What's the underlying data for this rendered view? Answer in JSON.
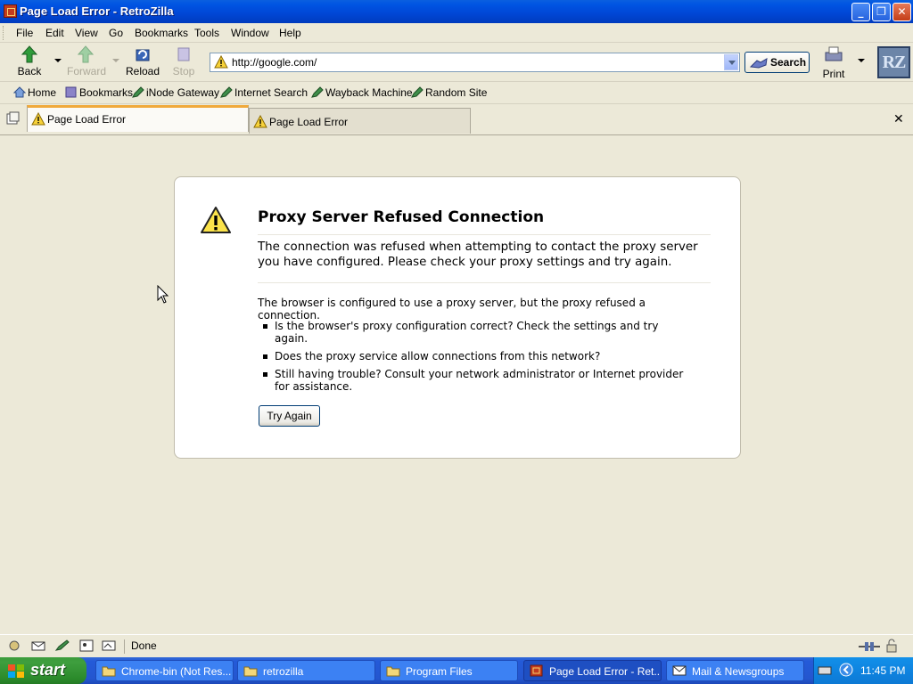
{
  "window": {
    "title": "Page Load Error - RetroZilla",
    "minimize": "_",
    "maximize": "❐",
    "close": "✕"
  },
  "menu": [
    "File",
    "Edit",
    "View",
    "Go",
    "Bookmarks",
    "Tools",
    "Window",
    "Help"
  ],
  "nav": {
    "back": "Back",
    "forward": "Forward",
    "reload": "Reload",
    "stop": "Stop",
    "url": "http://google.com/",
    "search": "Search",
    "print": "Print",
    "logo": "RZ"
  },
  "personal_toolbar": [
    "Home",
    "Bookmarks",
    "iNode Gateway",
    "Internet Search",
    "Wayback Machine",
    "Random Site"
  ],
  "tabs": [
    {
      "label": "Page Load Error",
      "active": true
    },
    {
      "label": "Page Load Error",
      "active": false
    }
  ],
  "tab_close": "✕",
  "error": {
    "title": "Proxy Server Refused Connection",
    "short": "The connection was refused when attempting to contact the proxy server you have configured. Please check your proxy settings and try again.",
    "long": "The browser is configured to use a proxy server, but the proxy refused a connection.",
    "bullets": [
      "Is the browser's proxy configuration correct? Check the settings and try again.",
      "Does the proxy service allow connections from this network?",
      "Still having trouble? Consult your network administrator or Internet provider for assistance."
    ],
    "button": "Try Again"
  },
  "status": "Done",
  "taskbar": {
    "start": "start",
    "tasks": [
      {
        "label": "Chrome-bin (Not Res...",
        "icon": "folder-icon",
        "active": false
      },
      {
        "label": "retrozilla",
        "icon": "folder-icon",
        "active": false
      },
      {
        "label": "Program Files",
        "icon": "folder-icon",
        "active": false
      },
      {
        "label": "Page Load Error - Ret...",
        "icon": "retrozilla-icon",
        "active": true
      },
      {
        "label": "Mail & Newsgroups",
        "icon": "mail-icon",
        "active": false
      }
    ],
    "clock": "11:45 PM"
  },
  "colors": {
    "titlebar": "#0054e3",
    "tab_accent": "#f0a93b",
    "chrome": "#ece9d8",
    "taskbar": "#245ad8",
    "start": "#3e9e3e"
  }
}
